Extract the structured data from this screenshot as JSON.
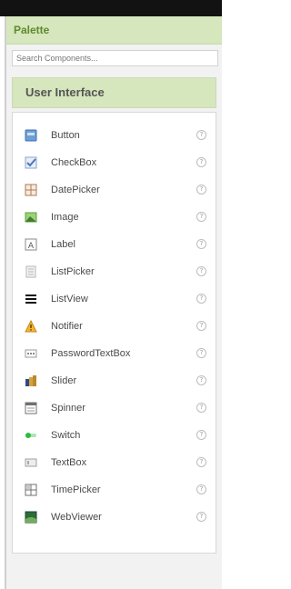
{
  "palette": {
    "title": "Palette"
  },
  "search": {
    "placeholder": "Search Components..."
  },
  "category": {
    "title": "User Interface"
  },
  "help_glyph": "?",
  "components": [
    {
      "label": "Button",
      "icon": "button-icon",
      "color": "#6d9fd6"
    },
    {
      "label": "CheckBox",
      "icon": "checkbox-icon",
      "color": "#4f75b8"
    },
    {
      "label": "DatePicker",
      "icon": "datepicker-icon",
      "color": "#b07a4f"
    },
    {
      "label": "Image",
      "icon": "image-icon",
      "color": "#5aa33d"
    },
    {
      "label": "Label",
      "icon": "label-icon",
      "color": "#8a8a8a"
    },
    {
      "label": "ListPicker",
      "icon": "listpicker-icon",
      "color": "#b5b5b5"
    },
    {
      "label": "ListView",
      "icon": "listview-icon",
      "color": "#111111"
    },
    {
      "label": "Notifier",
      "icon": "notifier-icon",
      "color": "#e3a21a"
    },
    {
      "label": "PasswordTextBox",
      "icon": "password-icon",
      "color": "#9a9a9a"
    },
    {
      "label": "Slider",
      "icon": "slider-icon",
      "color": "#b8892e"
    },
    {
      "label": "Spinner",
      "icon": "spinner-icon",
      "color": "#707070"
    },
    {
      "label": "Switch",
      "icon": "switch-icon",
      "color": "#2fb845"
    },
    {
      "label": "TextBox",
      "icon": "textbox-icon",
      "color": "#a0a0a0"
    },
    {
      "label": "TimePicker",
      "icon": "timepicker-icon",
      "color": "#707070"
    },
    {
      "label": "WebViewer",
      "icon": "webviewer-icon",
      "color": "#2d6b3a"
    }
  ]
}
